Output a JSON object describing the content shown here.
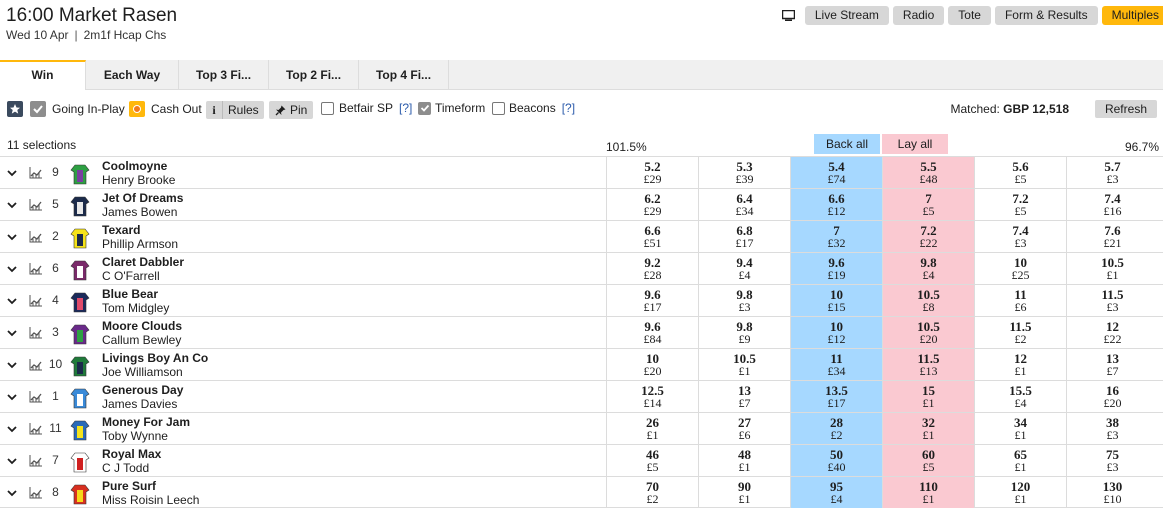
{
  "race": {
    "title": "16:00 Market Rasen",
    "date": "Wed 10 Apr",
    "separator": "|",
    "distance": "2m1f Hcap Chs"
  },
  "top_buttons": [
    "Live Stream",
    "Radio",
    "Tote",
    "Form & Results",
    "Multiples"
  ],
  "tabs": [
    "Win",
    "Each Way",
    "Top 3 Fi...",
    "Top 2 Fi...",
    "Top 4 Fi..."
  ],
  "toolbar": {
    "going_in_play": "Going In-Play",
    "cash_out": "Cash Out",
    "rules": "Rules",
    "pin": "Pin",
    "betfair_sp": "Betfair SP",
    "help1": "[?]",
    "timeform": "Timeform",
    "beacons": "Beacons",
    "help2": "[?]"
  },
  "matched": {
    "label": "Matched:",
    "value": "GBP 12,518"
  },
  "refresh": "Refresh",
  "selections_label": "11 selections",
  "book_back": "101.5%",
  "book_lay": "96.7%",
  "back_all": "Back all",
  "lay_all": "Lay all",
  "colors": {
    "back": "#a6d8ff",
    "lay": "#fac9d1",
    "accent": "#ffb80c"
  },
  "runners": [
    {
      "cloth": "9",
      "name": "Coolmoyne",
      "jockey": "Henry Brooke",
      "silk": [
        "#2ea043",
        "#7a3fa0"
      ],
      "prices": [
        [
          "5.2",
          "£29"
        ],
        [
          "5.3",
          "£39"
        ],
        [
          "5.4",
          "£74"
        ],
        [
          "5.5",
          "£48"
        ],
        [
          "5.6",
          "£5"
        ],
        [
          "5.7",
          "£3"
        ]
      ]
    },
    {
      "cloth": "5",
      "name": "Jet Of Dreams",
      "jockey": "James Bowen",
      "silk": [
        "#1b2a4a",
        "#e8e8e8"
      ],
      "prices": [
        [
          "6.2",
          "£29"
        ],
        [
          "6.4",
          "£34"
        ],
        [
          "6.6",
          "£12"
        ],
        [
          "7",
          "£5"
        ],
        [
          "7.2",
          "£5"
        ],
        [
          "7.4",
          "£16"
        ]
      ]
    },
    {
      "cloth": "2",
      "name": "Texard",
      "jockey": "Phillip Armson",
      "silk": [
        "#f5e31a",
        "#1b2a4a"
      ],
      "prices": [
        [
          "6.6",
          "£51"
        ],
        [
          "6.8",
          "£17"
        ],
        [
          "7",
          "£32"
        ],
        [
          "7.2",
          "£22"
        ],
        [
          "7.4",
          "£3"
        ],
        [
          "7.6",
          "£21"
        ]
      ]
    },
    {
      "cloth": "6",
      "name": "Claret Dabbler",
      "jockey": "C O'Farrell",
      "silk": [
        "#7a2a6a",
        "#ffffff"
      ],
      "prices": [
        [
          "9.2",
          "£28"
        ],
        [
          "9.4",
          "£4"
        ],
        [
          "9.6",
          "£19"
        ],
        [
          "9.8",
          "£4"
        ],
        [
          "10",
          "£25"
        ],
        [
          "10.5",
          "£1"
        ]
      ]
    },
    {
      "cloth": "4",
      "name": "Blue Bear",
      "jockey": "Tom Midgley",
      "silk": [
        "#1b2a5a",
        "#e04a6a"
      ],
      "prices": [
        [
          "9.6",
          "£17"
        ],
        [
          "9.8",
          "£3"
        ],
        [
          "10",
          "£15"
        ],
        [
          "10.5",
          "£8"
        ],
        [
          "11",
          "£6"
        ],
        [
          "11.5",
          "£3"
        ]
      ]
    },
    {
      "cloth": "3",
      "name": "Moore Clouds",
      "jockey": "Callum Bewley",
      "silk": [
        "#6a2a8a",
        "#2ea043"
      ],
      "prices": [
        [
          "9.6",
          "£84"
        ],
        [
          "9.8",
          "£9"
        ],
        [
          "10",
          "£12"
        ],
        [
          "10.5",
          "£20"
        ],
        [
          "11.5",
          "£2"
        ],
        [
          "12",
          "£22"
        ]
      ]
    },
    {
      "cloth": "10",
      "name": "Livings Boy An Co",
      "jockey": "Joe Williamson",
      "silk": [
        "#1f7a3a",
        "#1b2a4a"
      ],
      "prices": [
        [
          "10",
          "£20"
        ],
        [
          "10.5",
          "£1"
        ],
        [
          "11",
          "£34"
        ],
        [
          "11.5",
          "£13"
        ],
        [
          "12",
          "£1"
        ],
        [
          "13",
          "£7"
        ]
      ]
    },
    {
      "cloth": "1",
      "name": "Generous Day",
      "jockey": "James Davies",
      "silk": [
        "#3a8ad8",
        "#ffffff"
      ],
      "prices": [
        [
          "12.5",
          "£14"
        ],
        [
          "13",
          "£7"
        ],
        [
          "13.5",
          "£17"
        ],
        [
          "15",
          "£1"
        ],
        [
          "15.5",
          "£4"
        ],
        [
          "16",
          "£20"
        ]
      ]
    },
    {
      "cloth": "11",
      "name": "Money For Jam",
      "jockey": "Toby Wynne",
      "silk": [
        "#2a6ab8",
        "#f5e31a"
      ],
      "prices": [
        [
          "26",
          "£1"
        ],
        [
          "27",
          "£6"
        ],
        [
          "28",
          "£2"
        ],
        [
          "32",
          "£1"
        ],
        [
          "34",
          "£1"
        ],
        [
          "38",
          "£3"
        ]
      ]
    },
    {
      "cloth": "7",
      "name": "Royal Max",
      "jockey": "C J Todd",
      "silk": [
        "#ffffff",
        "#d02020"
      ],
      "prices": [
        [
          "46",
          "£5"
        ],
        [
          "48",
          "£1"
        ],
        [
          "50",
          "£40"
        ],
        [
          "60",
          "£5"
        ],
        [
          "65",
          "£1"
        ],
        [
          "75",
          "£3"
        ]
      ]
    },
    {
      "cloth": "8",
      "name": "Pure Surf",
      "jockey": "Miss Roisin Leech",
      "silk": [
        "#d83020",
        "#f5d81a"
      ],
      "prices": [
        [
          "70",
          "£2"
        ],
        [
          "90",
          "£1"
        ],
        [
          "95",
          "£4"
        ],
        [
          "110",
          "£1"
        ],
        [
          "120",
          "£1"
        ],
        [
          "130",
          "£10"
        ]
      ]
    }
  ]
}
